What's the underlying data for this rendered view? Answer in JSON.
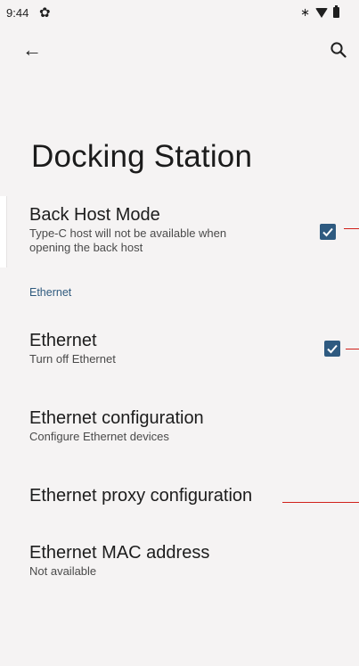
{
  "status_bar": {
    "time": "9:44",
    "icons": [
      "settings-gear-icon",
      "bluetooth-icon",
      "wifi-icon",
      "battery-icon"
    ]
  },
  "toolbar": {
    "back_icon": "arrow-back-icon",
    "search_icon": "search-icon"
  },
  "page": {
    "title": "Docking Station"
  },
  "back_host_mode": {
    "title": "Back Host Mode",
    "summary_line1": "Type-C host will not be available when",
    "summary_line2": "opening the back host",
    "checked": true
  },
  "ethernet_category": {
    "label": "Ethernet"
  },
  "ethernet": {
    "title": "Ethernet",
    "summary": "Turn off Ethernet",
    "checked": true
  },
  "ethernet_configuration": {
    "title": "Ethernet configuration",
    "summary": "Configure Ethernet devices"
  },
  "ethernet_proxy": {
    "title": "Ethernet proxy configuration"
  },
  "ethernet_mac": {
    "title": "Ethernet MAC address",
    "summary": "Not available"
  },
  "colors": {
    "background": "#f5f3f3",
    "accent": "#2e5a80",
    "category_text": "#2f5a7e",
    "annotation_line": "#d0201a"
  }
}
